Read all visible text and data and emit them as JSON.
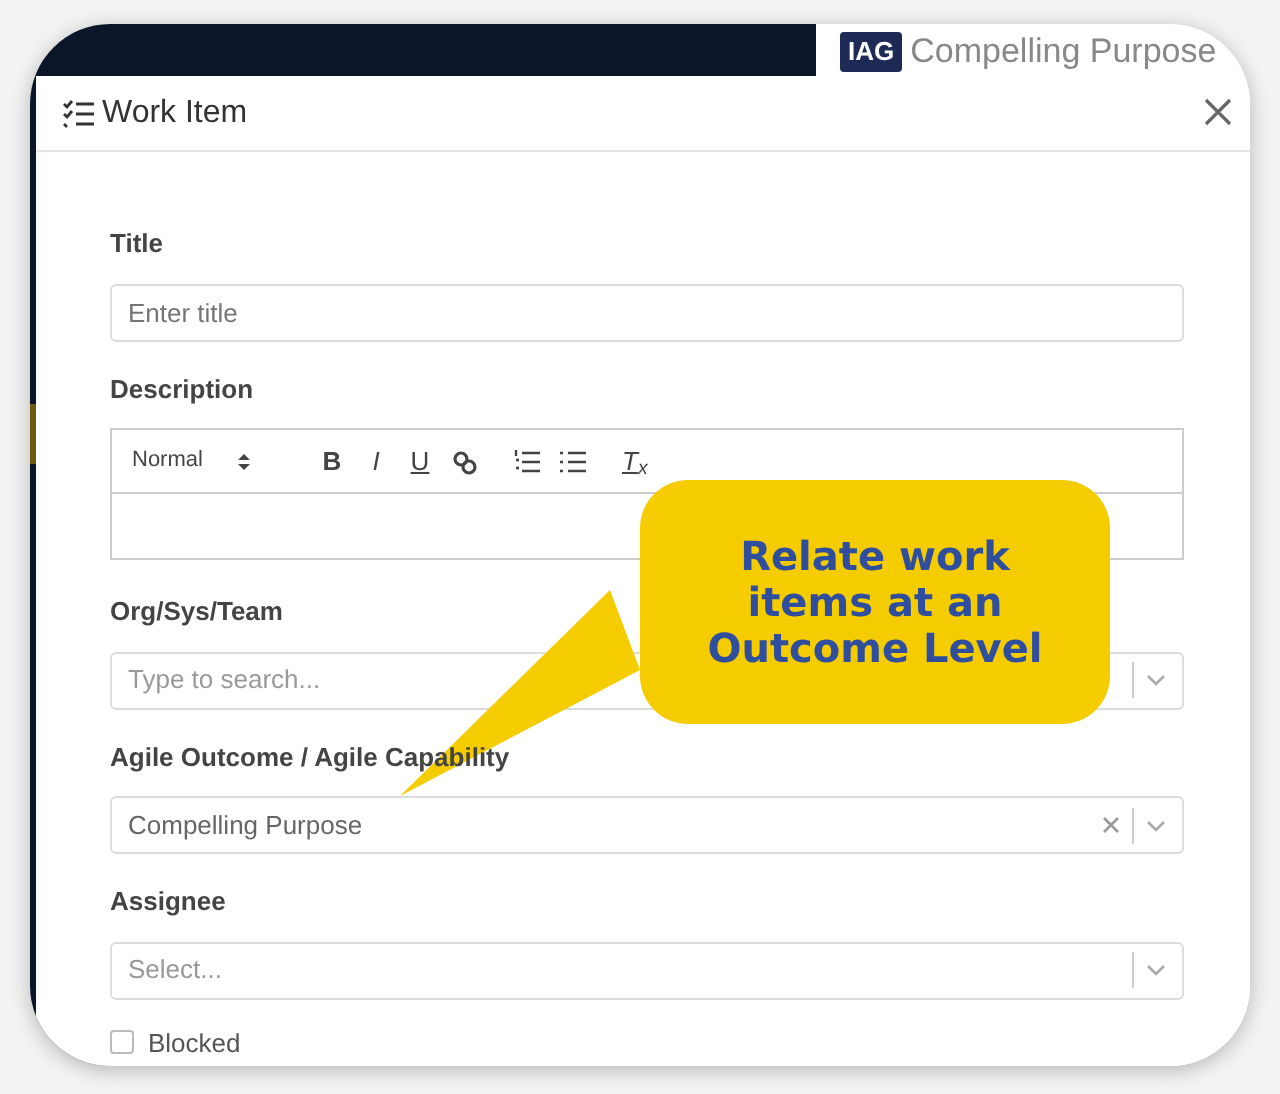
{
  "background": {
    "badge": "IAG",
    "heading": "Compelling Purpose"
  },
  "modal": {
    "title": "Work Item",
    "fields": [
      {
        "kind": "text",
        "label": "Title",
        "placeholder": "Enter title"
      },
      {
        "kind": "editor",
        "label": "Description",
        "toolbar": {
          "format": "Normal",
          "buttons": [
            {
              "kind": "bold",
              "label": "B"
            },
            {
              "kind": "italic",
              "label": "I"
            },
            {
              "kind": "underline",
              "label": "U"
            },
            {
              "kind": "link"
            },
            {
              "kind": "ordered-list"
            },
            {
              "kind": "bullet-list"
            },
            {
              "kind": "clear",
              "label": "T$_{x}$"
            }
          ]
        }
      },
      {
        "kind": "select",
        "label": "Org/Sys/Team",
        "placeholder": "Type to search..."
      },
      {
        "kind": "select",
        "label": "Agile Outcome / Agile Capability",
        "value": "Compelling Purpose",
        "clearable": true
      },
      {
        "kind": "select",
        "label": "Assignee",
        "placeholder": "Select..."
      },
      {
        "kind": "checkbox",
        "label": "Blocked",
        "checked": false
      }
    ]
  },
  "callout": {
    "text": "Relate work items at an Outcome Level"
  }
}
